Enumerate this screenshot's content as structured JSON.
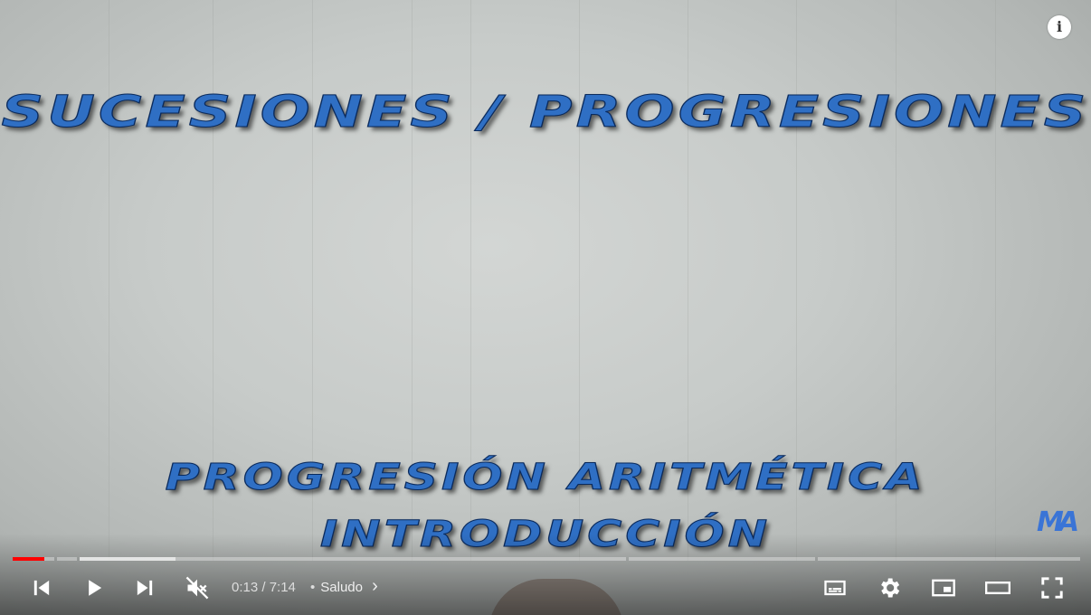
{
  "video": {
    "title_line1": "SUCESIONES / PROGRESIONES",
    "title_line2": "PROGRESIÓN ARITMÉTICA",
    "title_line3": "INTRODUCCIÓN",
    "watermark": "MA"
  },
  "player": {
    "info_label": "i",
    "current_time": "0:13",
    "duration": "7:14",
    "time_display": "0:13 / 7:14",
    "chapter_separator": "•",
    "chapter_title": "Saludo",
    "chapter_chevron": "›",
    "muted": true,
    "progress_played_fraction": 0.03,
    "colors": {
      "played": "#ff0000",
      "controls": "#ffffff"
    },
    "icons": {
      "previous": "skip-previous-icon",
      "play": "play-icon",
      "next": "skip-next-icon",
      "volume": "volume-muted-icon",
      "subtitles": "subtitles-icon",
      "settings": "gear-icon",
      "miniplayer": "miniplayer-icon",
      "theater": "theater-mode-icon",
      "fullscreen": "fullscreen-icon"
    }
  }
}
